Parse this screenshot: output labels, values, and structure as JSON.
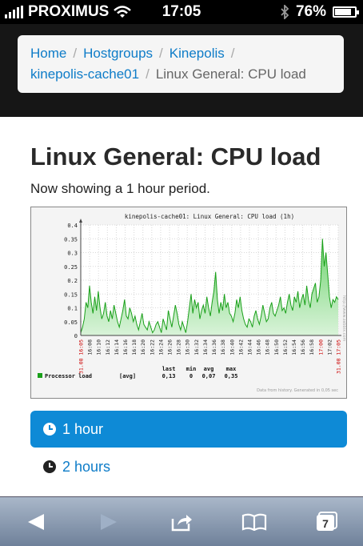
{
  "status_bar": {
    "carrier": "PROXIMUS",
    "time": "17:05",
    "battery": "76%",
    "battery_level": 0.76
  },
  "breadcrumb": {
    "items": [
      "Home",
      "Hostgroups",
      "Kinepolis",
      "kinepolis-cache01"
    ],
    "current": "Linux General: CPU load"
  },
  "page": {
    "title": "Linux General: CPU load",
    "subtitle": "Now showing a 1 hour period."
  },
  "periods": [
    {
      "label": "1 hour",
      "selected": true
    },
    {
      "label": "2 hours",
      "selected": false
    }
  ],
  "toolbar": {
    "icons": [
      "back-arrow-icon",
      "forward-arrow-icon",
      "share-icon",
      "bookmarks-icon",
      "tabs-icon"
    ],
    "tabs_count": "7"
  },
  "chart_data": {
    "type": "area",
    "title": "kinepolis-cache01: Linux General: CPU load  (1h)",
    "ylim": [
      0,
      0.4
    ],
    "y_ticks": [
      "0",
      "0.05",
      "0.1",
      "0.15",
      "0.2",
      "0.25",
      "0.3",
      "0.35",
      "0.4"
    ],
    "x_ticks": [
      "31.08 16:05",
      "16:08",
      "16:10",
      "16:12",
      "16:14",
      "16:16",
      "16:18",
      "16:20",
      "16:22",
      "16:24",
      "16:26",
      "16:28",
      "16:30",
      "16:32",
      "16:34",
      "16:36",
      "16:38",
      "16:40",
      "16:42",
      "16:44",
      "16:46",
      "16:48",
      "16:50",
      "16:52",
      "16:54",
      "16:56",
      "16:58",
      "17:00",
      "17:02",
      "31.08 17:05"
    ],
    "series": [
      {
        "name": "Processor load",
        "color": "#1aa01a",
        "values": [
          0.01,
          0.03,
          0.06,
          0.12,
          0.1,
          0.18,
          0.12,
          0.08,
          0.14,
          0.09,
          0.16,
          0.1,
          0.06,
          0.08,
          0.12,
          0.07,
          0.05,
          0.09,
          0.06,
          0.11,
          0.08,
          0.05,
          0.03,
          0.06,
          0.09,
          0.13,
          0.07,
          0.06,
          0.1,
          0.08,
          0.05,
          0.07,
          0.04,
          0.02,
          0.05,
          0.08,
          0.04,
          0.03,
          0.02,
          0.05,
          0.03,
          0.01,
          0.02,
          0.04,
          0.05,
          0.03,
          0.01,
          0.06,
          0.04,
          0.02,
          0.09,
          0.06,
          0.03,
          0.07,
          0.11,
          0.08,
          0.04,
          0.02,
          0.05,
          0.03,
          0.01,
          0.05,
          0.1,
          0.15,
          0.08,
          0.13,
          0.1,
          0.12,
          0.06,
          0.09,
          0.11,
          0.08,
          0.14,
          0.1,
          0.07,
          0.12,
          0.16,
          0.23,
          0.13,
          0.08,
          0.12,
          0.09,
          0.15,
          0.1,
          0.12,
          0.08,
          0.07,
          0.05,
          0.08,
          0.13,
          0.1,
          0.14,
          0.09,
          0.06,
          0.04,
          0.03,
          0.06,
          0.05,
          0.03,
          0.07,
          0.09,
          0.06,
          0.04,
          0.07,
          0.11,
          0.08,
          0.05,
          0.06,
          0.1,
          0.12,
          0.08,
          0.07,
          0.09,
          0.11,
          0.14,
          0.09,
          0.1,
          0.08,
          0.12,
          0.15,
          0.11,
          0.09,
          0.14,
          0.12,
          0.16,
          0.1,
          0.13,
          0.15,
          0.11,
          0.18,
          0.13,
          0.1,
          0.15,
          0.17,
          0.19,
          0.12,
          0.14,
          0.2,
          0.35,
          0.25,
          0.3,
          0.22,
          0.14,
          0.1,
          0.13,
          0.12,
          0.14,
          0.13
        ]
      }
    ],
    "legend": {
      "label": "Processor load",
      "agg": "[avg]",
      "headers": [
        "last",
        "min",
        "avg",
        "max"
      ],
      "values": [
        "0,13",
        "0",
        "0,07",
        "0,35"
      ]
    },
    "footer": "Data from history. Generated in 0,05 sec",
    "side_label": "http://www.zabbix.com"
  }
}
